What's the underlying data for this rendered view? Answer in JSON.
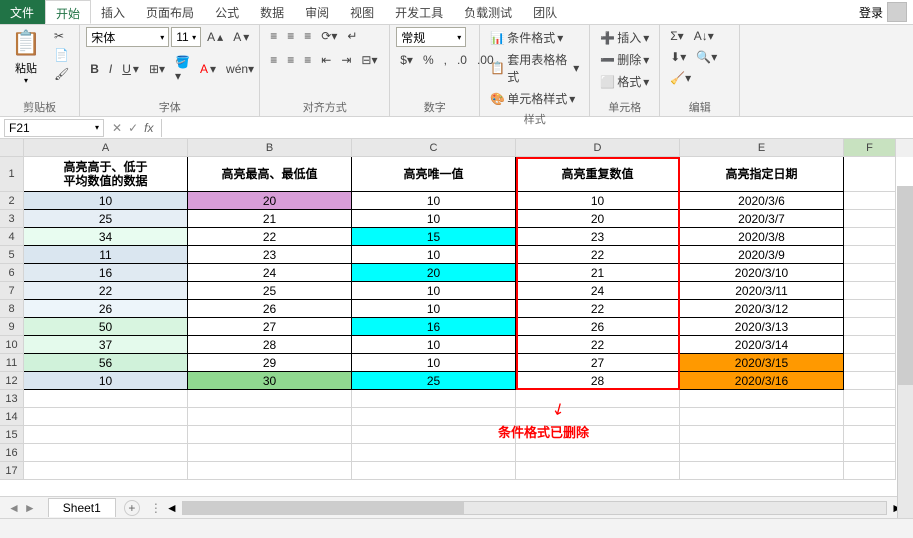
{
  "titlebar": {
    "tabs": [
      "文件",
      "开始",
      "插入",
      "页面布局",
      "公式",
      "数据",
      "审阅",
      "视图",
      "开发工具",
      "负载测试",
      "团队"
    ],
    "login": "登录"
  },
  "ribbon": {
    "clipboard": {
      "paste": "粘贴",
      "label": "剪贴板"
    },
    "font": {
      "name": "宋体",
      "size": "11",
      "label": "字体"
    },
    "align": {
      "label": "对齐方式"
    },
    "number": {
      "format": "常规",
      "label": "数字"
    },
    "styles": {
      "cond": "条件格式",
      "tbl": "套用表格格式",
      "cell": "单元格样式",
      "label": "样式"
    },
    "cells": {
      "ins": "插入",
      "del": "删除",
      "fmt": "格式",
      "label": "单元格"
    },
    "editing": {
      "label": "编辑"
    }
  },
  "namebox": {
    "ref": "F21"
  },
  "columns": [
    "A",
    "B",
    "C",
    "D",
    "E",
    "F"
  ],
  "headers": [
    "高亮高于、低于\n平均数值的数据",
    "高亮最高、最低值",
    "高亮唯一值",
    "高亮重复数值",
    "高亮指定日期"
  ],
  "data": [
    {
      "r": 2,
      "a": {
        "v": "10",
        "bg": "#dae6f0"
      },
      "b": {
        "v": "20",
        "bg": "#d89ed8"
      },
      "c": {
        "v": "10"
      },
      "d": {
        "v": "10"
      },
      "e": {
        "v": "2020/3/6"
      }
    },
    {
      "r": 3,
      "a": {
        "v": "25",
        "bg": "#e6eef5"
      },
      "b": {
        "v": "21"
      },
      "c": {
        "v": "10"
      },
      "d": {
        "v": "20"
      },
      "e": {
        "v": "2020/3/7"
      }
    },
    {
      "r": 4,
      "a": {
        "v": "34",
        "bg": "#e8fcf0"
      },
      "b": {
        "v": "22"
      },
      "c": {
        "v": "15",
        "bg": "#00ffff"
      },
      "d": {
        "v": "23"
      },
      "e": {
        "v": "2020/3/8"
      }
    },
    {
      "r": 5,
      "a": {
        "v": "11",
        "bg": "#dae6f0"
      },
      "b": {
        "v": "23"
      },
      "c": {
        "v": "10"
      },
      "d": {
        "v": "22"
      },
      "e": {
        "v": "2020/3/9"
      }
    },
    {
      "r": 6,
      "a": {
        "v": "16",
        "bg": "#e0eaf2"
      },
      "b": {
        "v": "24"
      },
      "c": {
        "v": "20",
        "bg": "#00ffff"
      },
      "d": {
        "v": "21"
      },
      "e": {
        "v": "2020/3/10"
      }
    },
    {
      "r": 7,
      "a": {
        "v": "22",
        "bg": "#e8f0f7"
      },
      "b": {
        "v": "25"
      },
      "c": {
        "v": "10"
      },
      "d": {
        "v": "24"
      },
      "e": {
        "v": "2020/3/11"
      }
    },
    {
      "r": 8,
      "a": {
        "v": "26",
        "bg": "#edf5fa"
      },
      "b": {
        "v": "26"
      },
      "c": {
        "v": "10"
      },
      "d": {
        "v": "22"
      },
      "e": {
        "v": "2020/3/12"
      }
    },
    {
      "r": 9,
      "a": {
        "v": "50",
        "bg": "#d8f5e0"
      },
      "b": {
        "v": "27"
      },
      "c": {
        "v": "16",
        "bg": "#00ffff"
      },
      "d": {
        "v": "26"
      },
      "e": {
        "v": "2020/3/13"
      }
    },
    {
      "r": 10,
      "a": {
        "v": "37",
        "bg": "#e4faec"
      },
      "b": {
        "v": "28"
      },
      "c": {
        "v": "10"
      },
      "d": {
        "v": "22"
      },
      "e": {
        "v": "2020/3/14"
      }
    },
    {
      "r": 11,
      "a": {
        "v": "56",
        "bg": "#d0f2da"
      },
      "b": {
        "v": "29"
      },
      "c": {
        "v": "10"
      },
      "d": {
        "v": "27"
      },
      "e": {
        "v": "2020/3/15",
        "bg": "#ff9900"
      }
    },
    {
      "r": 12,
      "a": {
        "v": "10",
        "bg": "#dae6f0"
      },
      "b": {
        "v": "30",
        "bg": "#90d890"
      },
      "c": {
        "v": "25",
        "bg": "#00ffff"
      },
      "d": {
        "v": "28"
      },
      "e": {
        "v": "2020/3/16",
        "bg": "#ff9900"
      }
    }
  ],
  "annotation": "条件格式已删除",
  "sheet": {
    "name": "Sheet1"
  }
}
